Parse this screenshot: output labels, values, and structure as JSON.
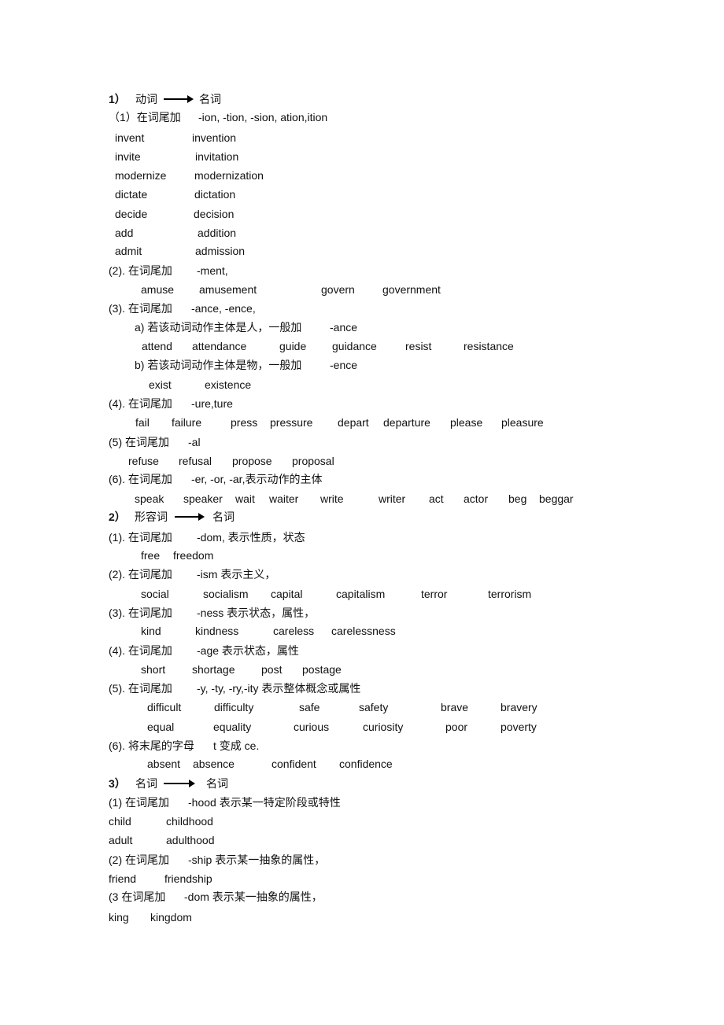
{
  "lines": [
    [
      "1）",
      "动词",
      "名词"
    ],
    [
      "（1）在词尾加",
      "-ion, -tion, -sion, ation,ition"
    ],
    [
      "invent",
      "invention"
    ],
    [
      "invite",
      "invitation"
    ],
    [
      "modernize",
      "modernization"
    ],
    [
      "dictate",
      "dictation"
    ],
    [
      "decide",
      "decision"
    ],
    [
      "add",
      "addition"
    ],
    [
      "admit",
      "admission"
    ],
    [
      "(2). 在词尾加",
      "-ment,"
    ],
    [
      "amuse",
      "amusement",
      "govern",
      "government"
    ],
    [
      "(3). 在词尾加",
      "-ance, -ence,"
    ],
    [
      "a) 若该动词动作主体是人，一般加",
      "-ance"
    ],
    [
      "attend",
      "attendance",
      "guide",
      "guidance",
      "resist",
      "resistance"
    ],
    [
      "b) 若该动词动作主体是物，一般加",
      "-ence"
    ],
    [
      "exist",
      "existence"
    ],
    [
      "(4). 在词尾加",
      "-ure,ture"
    ],
    [
      "fail",
      "failure",
      "press",
      "pressure",
      "depart",
      "departure",
      "please",
      "pleasure"
    ],
    [
      "(5) 在词尾加",
      "-al"
    ],
    [
      "refuse",
      "refusal",
      "propose",
      "proposal"
    ],
    [
      "(6). 在词尾加",
      "-er, -or, -ar,表示动作的主体"
    ],
    [
      "speak",
      "speaker",
      "wait",
      "waiter",
      "write",
      "writer",
      "act",
      "actor",
      "beg",
      "beggar"
    ],
    [
      "2）",
      "形容词",
      "名词"
    ],
    [
      "(1). 在词尾加",
      "-dom, 表示性质，状态"
    ],
    [
      "free",
      "freedom"
    ],
    [
      "(2). 在词尾加",
      "-ism 表示主义，"
    ],
    [
      "social",
      "socialism",
      "capital",
      "capitalism",
      "terror",
      "terrorism"
    ],
    [
      "(3). 在词尾加",
      "-ness 表示状态，属性，"
    ],
    [
      "kind",
      "kindness",
      "careless",
      "carelessness"
    ],
    [
      "(4). 在词尾加",
      "-age 表示状态，属性"
    ],
    [
      "short",
      "shortage",
      "post",
      "postage"
    ],
    [
      "(5). 在词尾加",
      "-y, -ty, -ry,-ity 表示整体概念或属性"
    ],
    [
      "difficult",
      "difficulty",
      "safe",
      "safety",
      "brave",
      "bravery"
    ],
    [
      "equal",
      "equality",
      "curious",
      "curiosity",
      "poor",
      "poverty"
    ],
    [
      "(6). 将末尾的字母",
      "t 变成 ce."
    ],
    [
      "absent",
      "absence",
      "confident",
      "confidence"
    ],
    [
      "3）",
      "名词",
      "名词"
    ],
    [
      "(1) 在词尾加",
      "-hood 表示某一特定阶段或特性"
    ],
    [
      "child",
      "childhood"
    ],
    [
      "adult",
      "adulthood"
    ],
    [
      "(2) 在词尾加",
      "-ship 表示某一抽象的属性，"
    ],
    [
      "friend",
      "friendship"
    ],
    [
      "(3 在词尾加",
      "-dom 表示某一抽象的属性，"
    ],
    [
      "king",
      "kingdom"
    ]
  ]
}
